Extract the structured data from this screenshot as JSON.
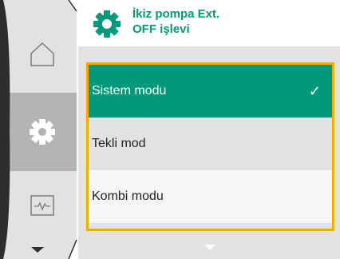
{
  "header": {
    "title_line1": "İkiz pompa Ext.",
    "title_line2": "OFF işlevi",
    "icon": "gear-icon"
  },
  "nav": {
    "items": [
      {
        "icon": "home-icon",
        "active": false
      },
      {
        "icon": "gear-icon",
        "active": true
      },
      {
        "icon": "diagnostics-icon",
        "active": false
      }
    ],
    "scroll_icon": "scroll-down-icon"
  },
  "list": {
    "items": [
      {
        "label": "Sistem modu",
        "selected": true
      },
      {
        "label": "Tekli mod",
        "selected": false
      },
      {
        "label": "Kombi modu",
        "selected": false
      }
    ],
    "check_mark": "✓",
    "scroll_icon": "scroll-down-icon"
  },
  "colors": {
    "accent": "#00997a",
    "focus": "#f5aa00",
    "nav_dark": "#2d2d2d",
    "nav_light": "#e2e2e3",
    "nav_active": "#b4b4b5"
  }
}
